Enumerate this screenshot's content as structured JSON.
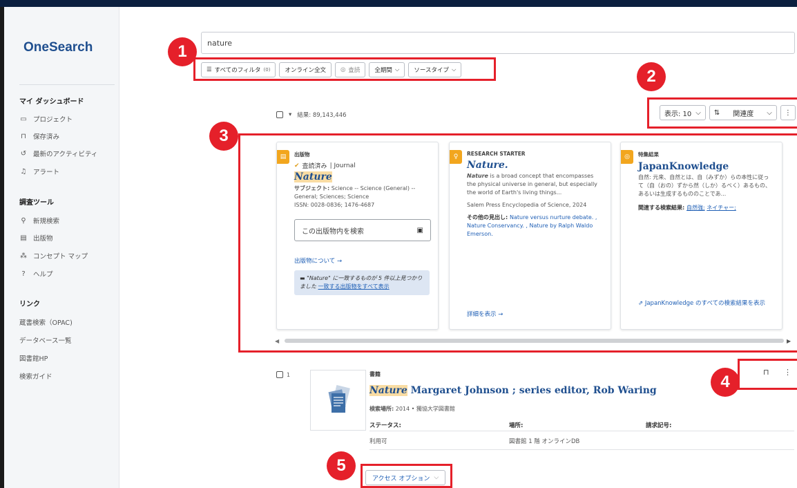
{
  "app": {
    "logo": "OneSearch"
  },
  "sidebar": {
    "heading_dashboard": "マイ ダッシュボード",
    "dashboard_items": [
      {
        "label": "プロジェクト",
        "icon": "folder-icon"
      },
      {
        "label": "保存済み",
        "icon": "bookmark-icon"
      },
      {
        "label": "最新のアクティビティ",
        "icon": "history-icon"
      },
      {
        "label": "アラート",
        "icon": "bell-icon"
      }
    ],
    "heading_tools": "調査ツール",
    "tool_items": [
      {
        "label": "新規検索",
        "icon": "search-icon"
      },
      {
        "label": "出版物",
        "icon": "document-icon"
      },
      {
        "label": "コンセプト マップ",
        "icon": "concept-map-icon"
      },
      {
        "label": "ヘルプ",
        "icon": "help-icon"
      }
    ],
    "heading_links": "リンク",
    "links": [
      "蔵書検索（OPAC)",
      "データベース一覧",
      "図書館HP",
      "検索ガイド"
    ]
  },
  "search": {
    "value": "nature"
  },
  "filters": {
    "all_filters": "すべてのフィルタ",
    "all_filters_count": "(0)",
    "online_fulltext": "オンライン全文",
    "peer_reviewed": "査読",
    "all_periods": "全期間",
    "source_type": "ソースタイプ"
  },
  "results": {
    "count_label": "結果: 89,143,446",
    "display_label": "表示: 10",
    "sort_label": "関連度"
  },
  "cards": {
    "publication": {
      "kind": "出版物",
      "peer_reviewed": "査読済み",
      "journal": "| Journal",
      "title": "Nature",
      "subject_label": "サブジェクト:",
      "subject_value": "Science -- Science (General) -- General; Sciences; Science",
      "issn": "ISSN: 0028-0836; 1476-4687",
      "search_within_placeholder": "この出版物内を検索",
      "about_link": "出版物について →",
      "notice_pre": "\"Nature\" に一致するものが 5 件以上見つかりました",
      "notice_link": "一致する出版物をすべて表示"
    },
    "research_starter": {
      "kind": "RESEARCH STARTER",
      "title": "Nature.",
      "summary_hl": "Nature",
      "summary_rest": " is a broad concept that encompasses the physical universe in general, but especially the world of Earth's living things...",
      "source": "Salem Press Encyclopedia of Science, 2024",
      "other_label": "その他の見出し: ",
      "other_items": [
        "Nature versus nurture debate. ,",
        "Nature Conservancy. ,",
        "Nature by Ralph Waldo Emerson."
      ],
      "details_link": "詳細を表示 →"
    },
    "featured": {
      "kind": "特集結果",
      "title": "JapanKnowledge",
      "summary": "自然: 元来、自然とは、自（みずか）らの本性に従って（自（おの）ずから然（しか）るべく）あるもの、あるいは生成するもののことであ...",
      "related_label": "関連する検索結果: ",
      "related_items": [
        "自然強;",
        "ネイチャー;"
      ],
      "all_results_link": "JapanKnowledge のすべての検索結果を表示"
    }
  },
  "result_item": {
    "number": "1",
    "type": "書籍",
    "title_hl": "Nature",
    "title_rest": " Margaret Johnson ; series editor, Rob Waring",
    "location_label": "検索場所:",
    "location_value": " 2014 • 獨協大学図書館",
    "status_label": "ステータス:",
    "place_label": "場所:",
    "callno_label": "請求記号:",
    "status_value": "利用可",
    "place_value": "図書館 1 階 オンラインDB",
    "access_button": "アクセス オプション"
  },
  "annotations": [
    "1",
    "2",
    "3",
    "4",
    "5"
  ],
  "colors": {
    "accent_red": "#e5202a",
    "brand_blue": "#1f4f8f",
    "link_blue": "#1f5fb5",
    "highlight": "#f9dca3"
  }
}
